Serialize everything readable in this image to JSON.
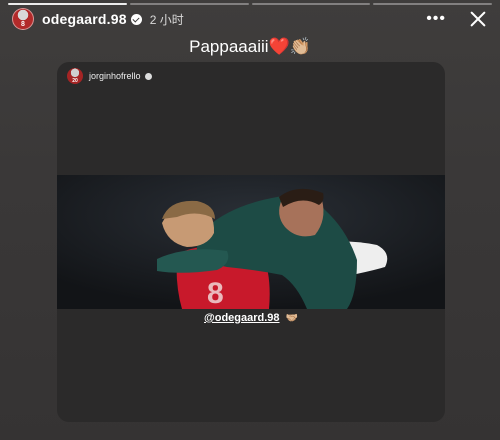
{
  "story": {
    "progress_segments": 4,
    "progress_completed": 1,
    "user": {
      "username": "odegaard.98",
      "avatar_number": "8",
      "verified": true
    },
    "timestamp": "2 小时",
    "more_icon": "more-horizontal-icon",
    "close_icon": "close-icon",
    "caption": "Pappaaaiii❤️👏🏼"
  },
  "shared_post": {
    "username": "jorginhofrello",
    "avatar_number": "20",
    "verified": true,
    "mention": "@odegaard.98",
    "mention_emoji": "🤝🏼",
    "photo_jersey_number": "8"
  },
  "colors": {
    "background": "#3a3838",
    "card": "#2b2a2a",
    "jersey_red": "#c8192b",
    "jacket_green": "#1d4b45"
  }
}
